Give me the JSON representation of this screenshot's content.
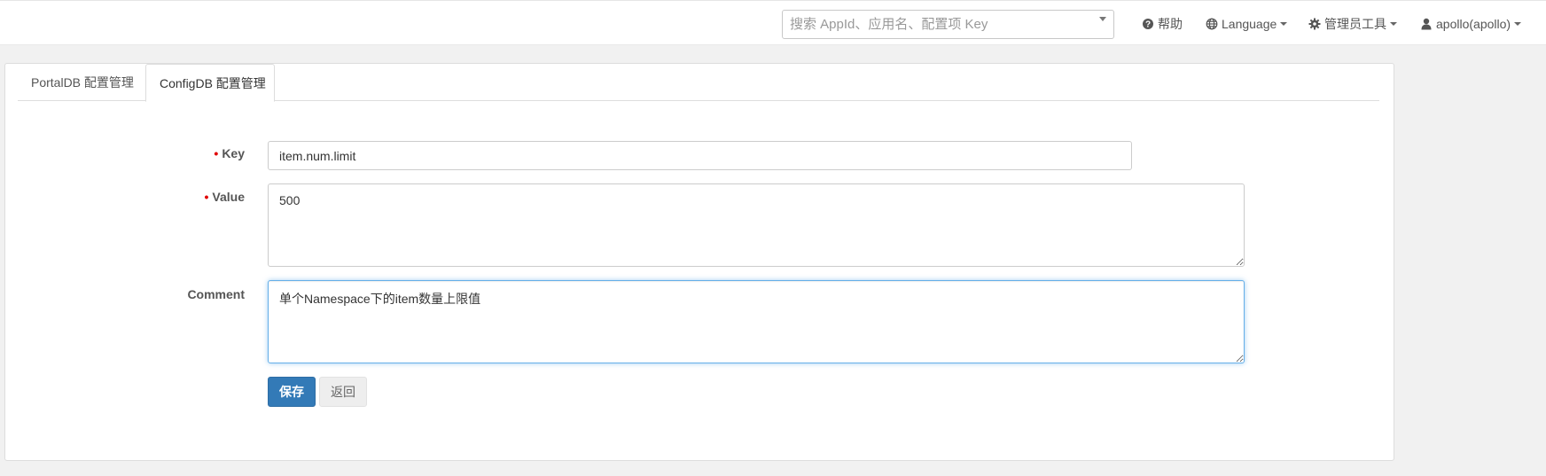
{
  "header": {
    "search_placeholder": "搜索 AppId、应用名、配置项 Key",
    "help_label": "帮助",
    "help_icon": "question-circle-icon",
    "language_label": "Language",
    "language_icon": "globe-icon",
    "admin_tools_label": "管理员工具",
    "admin_tools_icon": "gear-icon",
    "user_label": "apollo(apollo)",
    "user_icon": "user-icon"
  },
  "tabs": [
    {
      "label": "PortalDB 配置管理",
      "active": false
    },
    {
      "label": "ConfigDB 配置管理",
      "active": true
    }
  ],
  "form": {
    "key_label": "Key",
    "key_value": "item.num.limit",
    "value_label": "Value",
    "value_value": "500",
    "comment_label": "Comment",
    "comment_value": "单个Namespace下的item数量上限值",
    "required_marker": "•"
  },
  "buttons": {
    "save_label": "保存",
    "back_label": "返回"
  },
  "colors": {
    "primary": "#337ab7",
    "required": "#e00000",
    "focus_border": "#66afe9"
  }
}
